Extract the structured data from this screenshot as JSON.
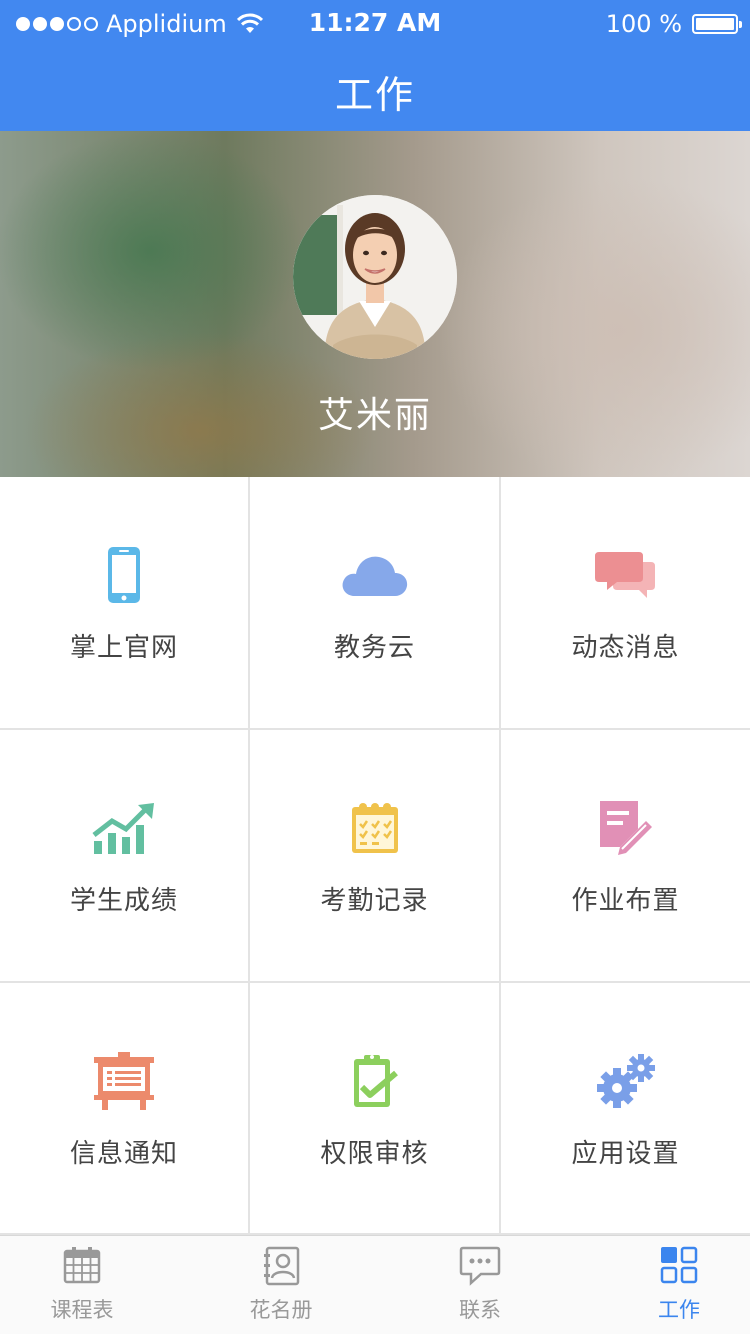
{
  "status_bar": {
    "carrier": "Applidium",
    "time": "11:27 AM",
    "battery": "100 %"
  },
  "header": {
    "title": "工作"
  },
  "profile": {
    "name": "艾米丽"
  },
  "grid": {
    "items": [
      {
        "label": "掌上官网",
        "icon": "mobile-phone-icon",
        "color": "#5bb8e8"
      },
      {
        "label": "教务云",
        "icon": "cloud-icon",
        "color": "#86a8ea"
      },
      {
        "label": "动态消息",
        "icon": "chat-bubbles-icon",
        "color": "#ec8f92"
      },
      {
        "label": "学生成绩",
        "icon": "growth-chart-icon",
        "color": "#62bfa0"
      },
      {
        "label": "考勤记录",
        "icon": "calendar-check-icon",
        "color": "#f0c24b"
      },
      {
        "label": "作业布置",
        "icon": "note-pencil-icon",
        "color": "#e190b6"
      },
      {
        "label": "信息通知",
        "icon": "notice-board-icon",
        "color": "#ec8a6c"
      },
      {
        "label": "权限审核",
        "icon": "clipboard-check-icon",
        "color": "#8ccf5d"
      },
      {
        "label": "应用设置",
        "icon": "gears-icon",
        "color": "#7a9fe8"
      }
    ]
  },
  "tabbar": {
    "tabs": [
      {
        "label": "课程表",
        "icon": "calendar-icon",
        "active": false
      },
      {
        "label": "花名册",
        "icon": "contacts-book-icon",
        "active": false
      },
      {
        "label": "联系",
        "icon": "message-icon",
        "active": false
      },
      {
        "label": "工作",
        "icon": "grid-apps-icon",
        "active": true
      }
    ],
    "active_color": "#3b85ee",
    "inactive_color": "#999999"
  },
  "colors": {
    "header": "#4288f0"
  }
}
